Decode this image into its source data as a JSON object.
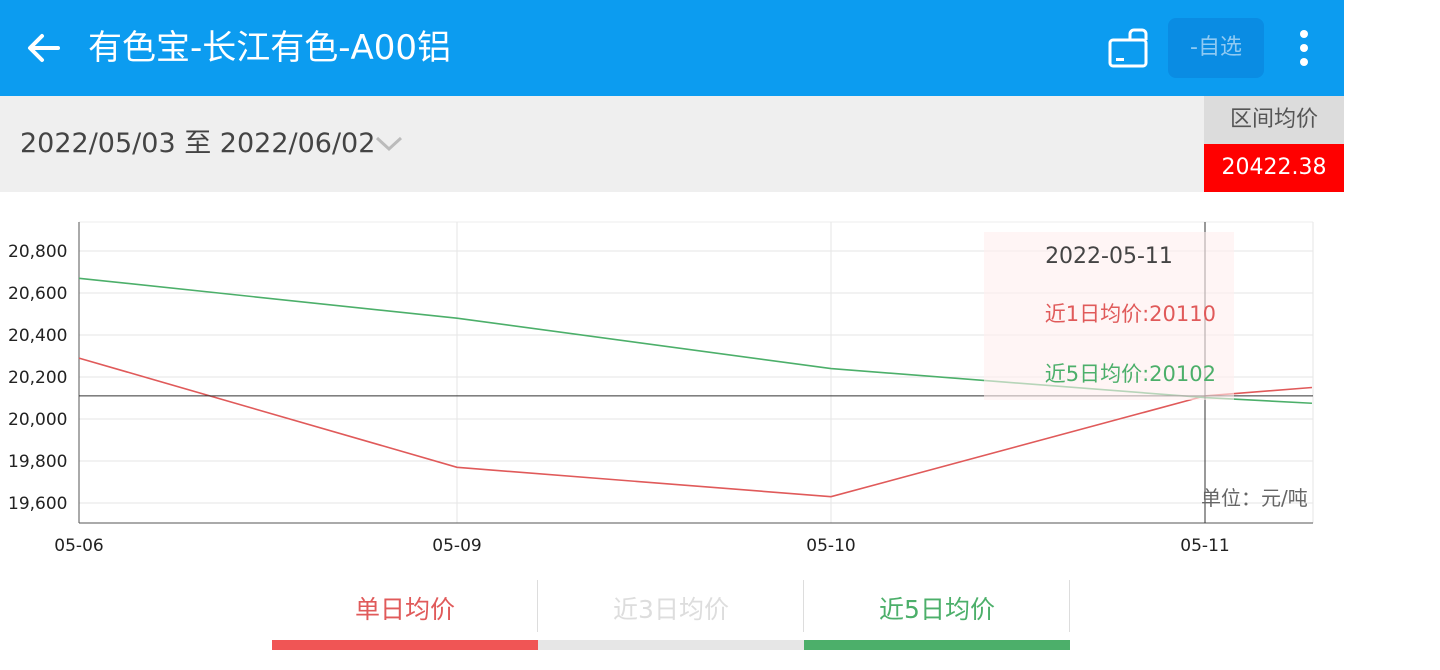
{
  "header": {
    "title": "有色宝-长江有色-A00铝",
    "watchlist_label": "-自选",
    "icons": [
      "back-arrow-icon",
      "landscape-rotate-icon",
      "more-vertical-icon"
    ]
  },
  "range": {
    "text": "2022/05/03 至 2022/06/02",
    "avg_label": "区间均价",
    "avg_value": "20422.38"
  },
  "chart_data": {
    "type": "line",
    "categories": [
      "05-06",
      "05-09",
      "05-10",
      "05-11"
    ],
    "ylim": [
      19500,
      20850
    ],
    "yticks": [
      "20,800",
      "20,600",
      "20,400",
      "20,200",
      "20,000",
      "19,800",
      "19,600"
    ],
    "series": [
      {
        "name": "近1日均价",
        "color": "#e05a5a",
        "values": [
          20290,
          19770,
          19630,
          20110,
          20150
        ]
      },
      {
        "name": "近5日均价",
        "color": "#4caf6a",
        "values": [
          20670,
          20480,
          20240,
          20102,
          20075
        ]
      }
    ],
    "crosshair_value": 20110,
    "unit": "单位：元/吨",
    "grid": true
  },
  "tooltip": {
    "date": "2022-05-11",
    "s1": "近1日均价:20110",
    "s5": "近5日均价:20102"
  },
  "tabs": [
    {
      "label": "单日均价",
      "color": "#e05a5a",
      "bar_color": "#f05555"
    },
    {
      "label": "近3日均价",
      "color": "#dddddd",
      "bar_color": "#e6e6e6"
    },
    {
      "label": "近5日均价",
      "color": "#4caf6a",
      "bar_color": "#4caf6a"
    }
  ]
}
